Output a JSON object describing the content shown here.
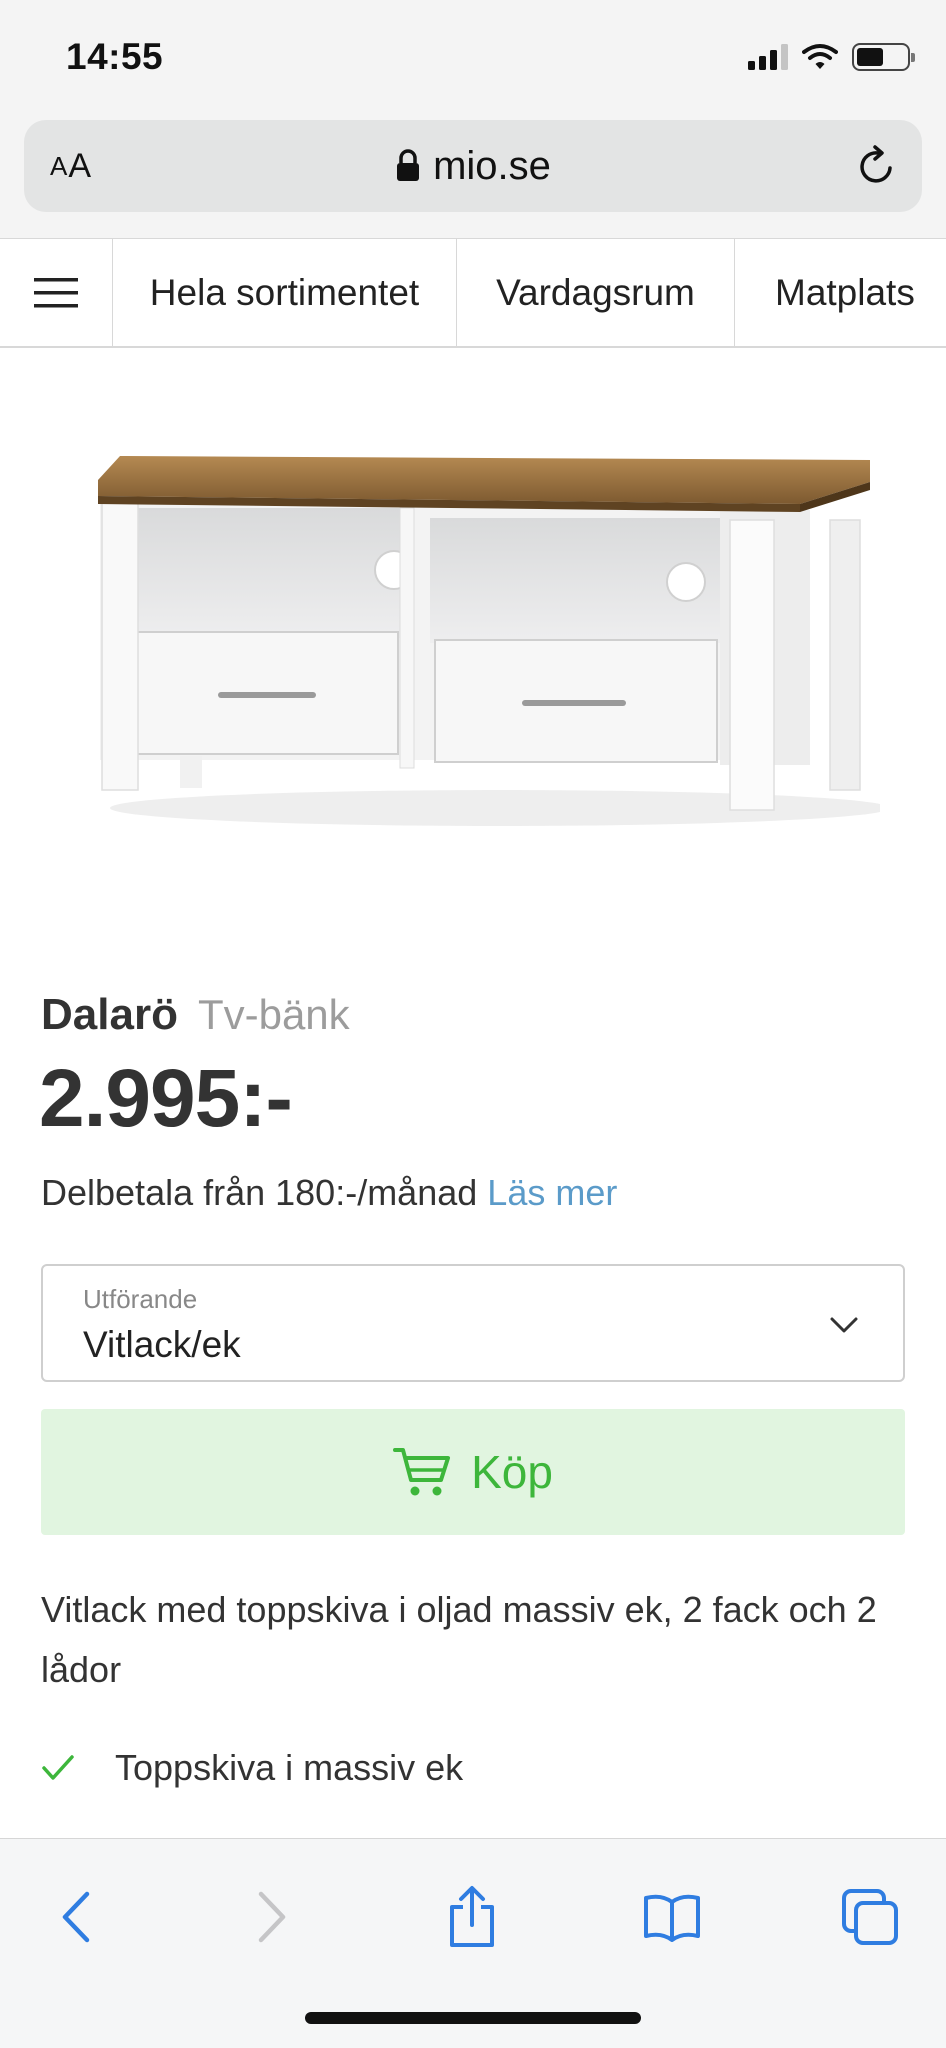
{
  "status_bar": {
    "time": "14:55",
    "icons": [
      "cellular-signal-icon",
      "wifi-icon",
      "battery-icon"
    ]
  },
  "browser": {
    "text_size_label": {
      "small": "A",
      "large": "A"
    },
    "url": "mio.se",
    "icons": [
      "lock-icon",
      "reload-icon"
    ]
  },
  "site_nav": {
    "menu_icon": "hamburger-menu-icon",
    "items": [
      {
        "label": "Hela sortimentet"
      },
      {
        "label": "Vardagsrum"
      },
      {
        "label": "Matplats"
      }
    ]
  },
  "product": {
    "name": "Dalarö",
    "type": "Tv-bänk",
    "price": "2.995:-",
    "installment_text": "Delbetala från 180:-/månad",
    "read_more": "Läs mer",
    "variant": {
      "label": "Utförande",
      "value": "Vitlack/ek"
    },
    "buy_label": "Köp",
    "description": "Vitlack med toppskiva i oljad massiv ek, 2 fack och 2 lådor",
    "features": [
      "Toppskiva i massiv ek"
    ]
  },
  "colors": {
    "accent_green": "#3db63b",
    "buy_background": "#e1f5e0",
    "link_blue": "#5b9bc9",
    "ios_blue": "#2f7de1"
  },
  "toolbar": {
    "icons": [
      "back-icon",
      "forward-icon",
      "share-icon",
      "bookmarks-icon",
      "tabs-icon"
    ]
  }
}
